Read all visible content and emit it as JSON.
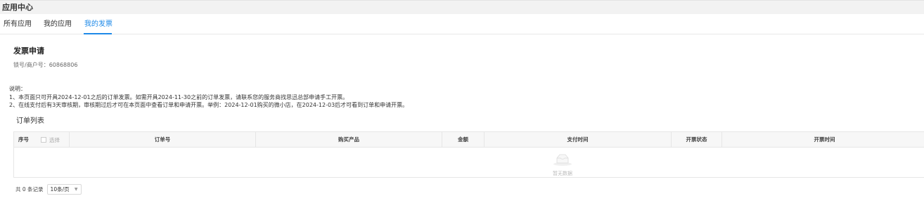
{
  "header": {
    "title": "应用中心"
  },
  "tabs": [
    {
      "label": "所有应用",
      "active": false
    },
    {
      "label": "我的应用",
      "active": false
    },
    {
      "label": "我的发票",
      "active": true
    }
  ],
  "page": {
    "title": "发票申请",
    "account": "锁号/商户号：60868806"
  },
  "notes": {
    "heading": "说明：",
    "line1": "1、本页面只可开具2024-12-01之后的订单发票。如需开具2024-11-30之前的订单发票，请联系您的服务商找思迅总部申请手工开票。",
    "line2": "2、在线支付后有3天审核期，审核期过后才可在本页面中查看订单和申请开票。举例：2024-12-01购买的微小店，在2024-12-03后才可看到订单和申请开票。"
  },
  "order_list": {
    "title": "订单列表",
    "columns": {
      "index": "序号",
      "select": "选择",
      "order_no": "订单号",
      "product": "购买产品",
      "amount": "金额",
      "pay_time": "支付时间",
      "invoice_status": "开票状态",
      "invoice_time": "开票时间"
    },
    "empty_text": "暂无数据"
  },
  "pagination": {
    "total": "共 0 条记录",
    "page_size": "10条/页"
  },
  "colors": {
    "accent": "#1f8ae8",
    "header_bg": "#f2f2f2",
    "table_header_bg": "#f7f7f7"
  },
  "icons": {
    "empty": "empty-box-icon",
    "dropdown": "chevron-down-icon"
  }
}
